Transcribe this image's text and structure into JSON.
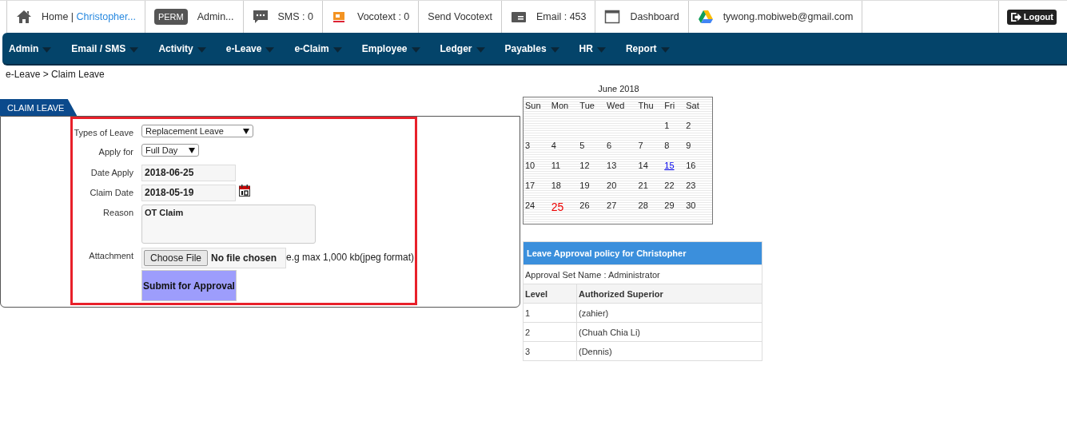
{
  "topbar": {
    "items": [
      {
        "kind": "home",
        "text": "Home | ",
        "link": "Christopher..."
      },
      {
        "kind": "perm",
        "badge": "PERM",
        "text": "Admin..."
      },
      {
        "kind": "chat",
        "text": "SMS : 0"
      },
      {
        "kind": "voco",
        "text": "Vocotext : 0"
      },
      {
        "kind": "plain",
        "text": "Send Vocotext"
      },
      {
        "kind": "mail",
        "text": "Email : 453"
      },
      {
        "kind": "window",
        "text": "Dashboard"
      },
      {
        "kind": "drive",
        "text": "tywong.mobiweb@gmail.com"
      }
    ],
    "logout": "Logout"
  },
  "nav": [
    "Admin",
    "Email / SMS",
    "Activity",
    "e-Leave",
    "e-Claim",
    "Employee",
    "Ledger",
    "Payables",
    "HR",
    "Report"
  ],
  "breadcrumb": "e-Leave > Claim Leave",
  "panel_tab": "CLAIM LEAVE",
  "form": {
    "types_label": "Types of Leave",
    "types_value": "Replacement Leave",
    "apply_label": "Apply for",
    "apply_value": "Full Day",
    "date_apply_label": "Date Apply",
    "date_apply": "2018-06-25",
    "claim_date_label": "Claim Date",
    "claim_date": "2018-05-19",
    "reason_label": "Reason",
    "reason": "OT Claim",
    "attachment_label": "Attachment",
    "choose_file": "Choose File",
    "no_file": "No file chosen",
    "hint": "e.g max 1,000 kb(jpeg format)",
    "submit": "Submit for Approval"
  },
  "calendar": {
    "title": "June 2018",
    "weekdays": [
      "Sun",
      "Mon",
      "Tue",
      "Wed",
      "Thu",
      "Fri",
      "Sat"
    ],
    "weeks": [
      [
        {
          "kind": "blank"
        },
        {
          "kind": "blank"
        },
        {
          "kind": "blank"
        },
        {
          "kind": "blank"
        },
        {
          "kind": "blank"
        },
        {
          "kind": "plain",
          "day": "1"
        },
        {
          "kind": "plain",
          "day": "2"
        }
      ],
      [
        {
          "kind": "plain",
          "day": "3"
        },
        {
          "kind": "plain",
          "day": "4"
        },
        {
          "kind": "plain",
          "day": "5"
        },
        {
          "kind": "plain",
          "day": "6"
        },
        {
          "kind": "plain",
          "day": "7"
        },
        {
          "kind": "plain",
          "day": "8"
        },
        {
          "kind": "plain",
          "day": "9"
        }
      ],
      [
        {
          "kind": "plain",
          "day": "10"
        },
        {
          "kind": "plain",
          "day": "11"
        },
        {
          "kind": "plain",
          "day": "12"
        },
        {
          "kind": "plain",
          "day": "13"
        },
        {
          "kind": "plain",
          "day": "14"
        },
        {
          "kind": "link",
          "day": "15"
        },
        {
          "kind": "plain",
          "day": "16"
        }
      ],
      [
        {
          "kind": "plain",
          "day": "17"
        },
        {
          "kind": "plain",
          "day": "18"
        },
        {
          "kind": "plain",
          "day": "19"
        },
        {
          "kind": "plain",
          "day": "20"
        },
        {
          "kind": "plain",
          "day": "21"
        },
        {
          "kind": "plain",
          "day": "22"
        },
        {
          "kind": "plain",
          "day": "23"
        }
      ],
      [
        {
          "kind": "plain",
          "day": "24"
        },
        {
          "kind": "today",
          "day": "25"
        },
        {
          "kind": "plain",
          "day": "26"
        },
        {
          "kind": "plain",
          "day": "27"
        },
        {
          "kind": "plain",
          "day": "28"
        },
        {
          "kind": "plain",
          "day": "29"
        },
        {
          "kind": "plain",
          "day": "30"
        }
      ]
    ]
  },
  "policy": {
    "title": "Leave Approval policy for Christopher",
    "set_name": "Approval Set Name : Administrator",
    "columns": [
      "Level",
      "Authorized Superior"
    ],
    "rows": [
      [
        "1",
        "(zahier)"
      ],
      [
        "2",
        "(Chuah Chia Li)"
      ],
      [
        "3",
        "(Dennis)"
      ]
    ]
  }
}
